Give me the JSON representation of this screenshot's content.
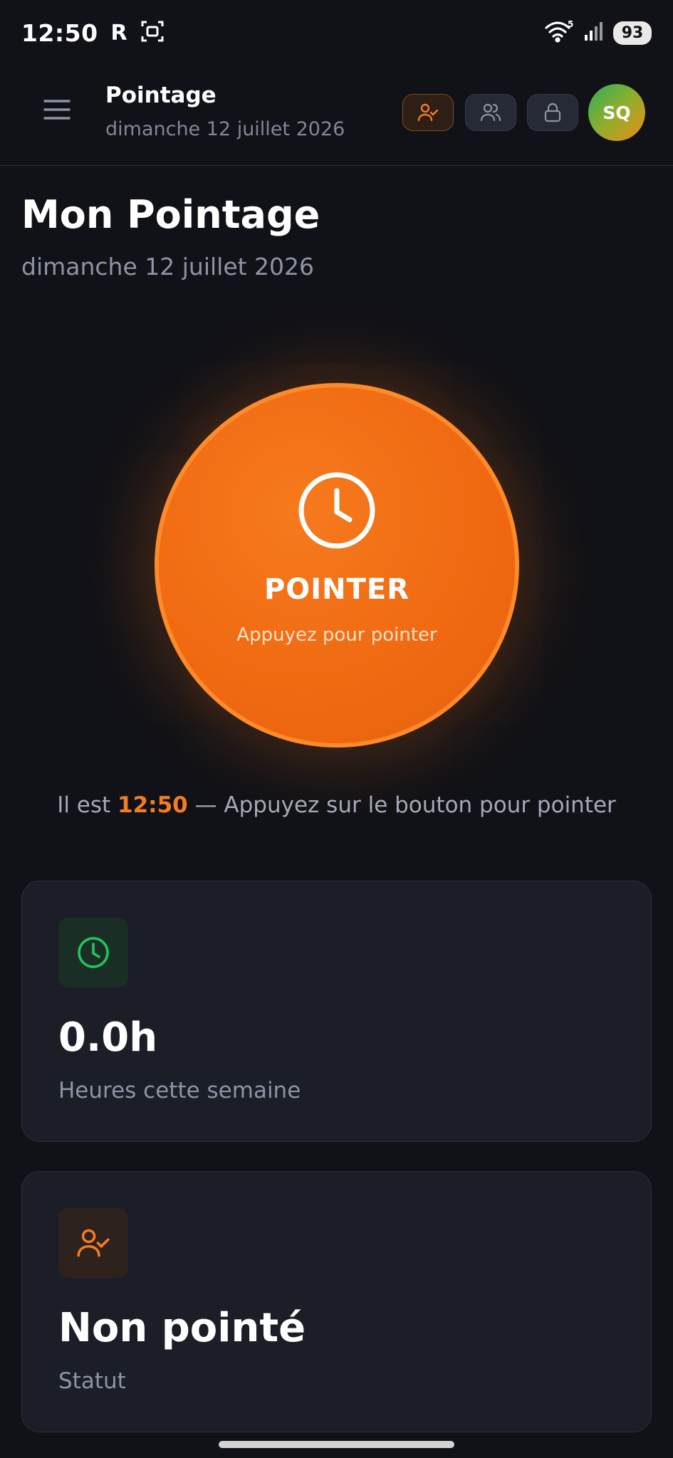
{
  "status_bar": {
    "time": "12:50",
    "carrier_glyph": "R",
    "wifi_badge": "5",
    "battery": "93"
  },
  "header": {
    "title": "Pointage",
    "date": "dimanche 12 juillet 2026",
    "avatar_initials": "SQ"
  },
  "page": {
    "title": "Mon Pointage",
    "date": "dimanche 12 juillet 2026"
  },
  "punch": {
    "label": "POINTER",
    "hint": "Appuyez pour pointer"
  },
  "info": {
    "prefix": "Il est ",
    "time": "12:50",
    "suffix": " — Appuyez sur le bouton pour pointer"
  },
  "cards": [
    {
      "value": "0.0h",
      "label": "Heures cette semaine",
      "icon": "clock-icon",
      "color": "#22c55e"
    },
    {
      "value": "Non pointé",
      "label": "Statut",
      "icon": "user-check-icon",
      "color": "#f57c22"
    }
  ],
  "colors": {
    "accent": "#f06a12",
    "background": "#111217",
    "card": "#1b1d27"
  }
}
